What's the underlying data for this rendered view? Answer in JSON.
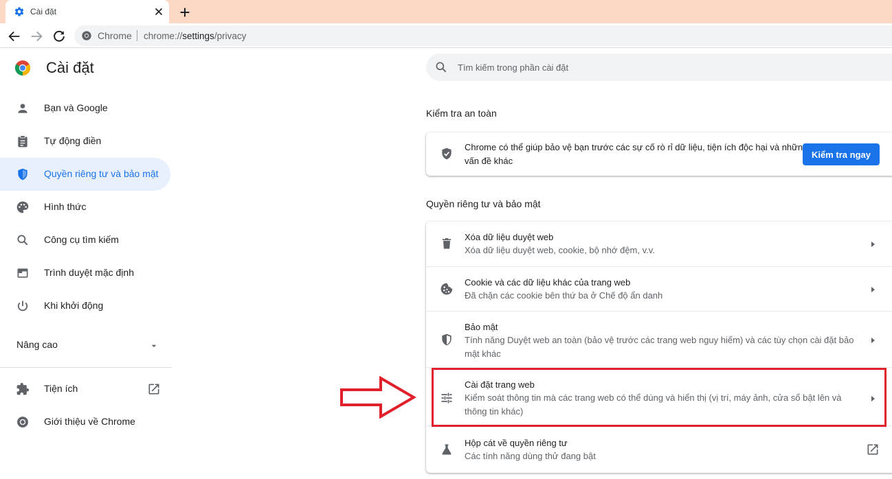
{
  "browser": {
    "tab_title": "Cài đặt",
    "chip": "Chrome",
    "url_scheme": "chrome://",
    "url_host": "settings",
    "url_path": "/privacy"
  },
  "colors": {
    "accent": "#1a73e8",
    "active_nav_bg": "#e8f0fe",
    "tabstrip_bg": "#fbd9c5",
    "highlight_red": "#e0202a"
  },
  "sidebar": {
    "title": "Cài đặt",
    "items": [
      {
        "label": "Bạn và Google",
        "icon": "person-icon"
      },
      {
        "label": "Tự động điền",
        "icon": "clipboard-icon"
      },
      {
        "label": "Quyền riêng tư và bảo mật",
        "icon": "shield-icon",
        "active": true
      },
      {
        "label": "Hình thức",
        "icon": "palette-icon"
      },
      {
        "label": "Công cụ tìm kiếm",
        "icon": "search-icon"
      },
      {
        "label": "Trình duyệt mặc định",
        "icon": "browser-window-icon"
      },
      {
        "label": "Khi khởi động",
        "icon": "power-icon"
      }
    ],
    "advanced": "Nâng cao",
    "extensions": "Tiện ích",
    "about": "Giới thiệu về Chrome"
  },
  "search": {
    "placeholder": "Tìm kiếm trong phần cài đặt"
  },
  "safety_check": {
    "heading": "Kiểm tra an toàn",
    "text": "Chrome có thể giúp bảo vệ bạn trước các sự cố rò rỉ dữ liệu, tiện ích độc hại và những vấn đề khác",
    "button": "Kiểm tra ngay"
  },
  "privacy": {
    "heading": "Quyền riêng tư và bảo mật",
    "rows": [
      {
        "title": "Xóa dữ liệu duyệt web",
        "subtitle": "Xóa dữ liệu duyệt web, cookie, bộ nhớ đệm, v.v.",
        "icon": "trash-icon"
      },
      {
        "title": "Cookie và các dữ liệu khác của trang web",
        "subtitle": "Đã chặn các cookie bên thứ ba ở Chế độ ẩn danh",
        "icon": "cookie-icon"
      },
      {
        "title": "Bảo mật",
        "subtitle": "Tính năng Duyệt web an toàn (bảo vệ trước các trang web nguy hiểm) và các tùy chọn cài đặt bảo mật khác",
        "icon": "security-shield-icon"
      },
      {
        "title": "Cài đặt trang web",
        "subtitle": "Kiểm soát thông tin mà các trang web có thể dùng và hiển thị (vị trí, máy ảnh, cửa sổ bật lên và thông tin khác)",
        "icon": "tune-sliders-icon"
      },
      {
        "title": "Hộp cát về quyền riêng tư",
        "subtitle": "Các tính năng dùng thử đang bật",
        "icon": "flask-icon"
      }
    ]
  }
}
